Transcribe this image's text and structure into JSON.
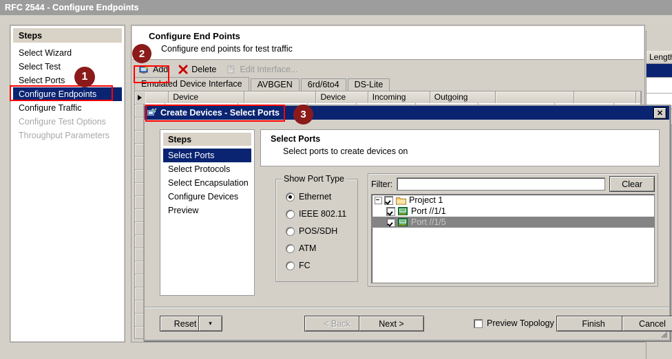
{
  "window": {
    "title": "RFC 2544 - Configure Endpoints"
  },
  "steps_panel": {
    "header": "Steps",
    "items": [
      {
        "label": "Select Wizard",
        "state": "normal"
      },
      {
        "label": "Select Test",
        "state": "normal"
      },
      {
        "label": "Select Ports",
        "state": "normal"
      },
      {
        "label": "Configure Endpoints",
        "state": "selected"
      },
      {
        "label": "Configure Traffic",
        "state": "normal"
      },
      {
        "label": "Configure Test Options",
        "state": "disabled"
      },
      {
        "label": "Throughput Parameters",
        "state": "disabled"
      }
    ]
  },
  "content": {
    "title": "Configure End Points",
    "subtitle": "Configure end points for test traffic",
    "toolbar": [
      {
        "label": "Add",
        "icon": "add-device-icon",
        "enabled": true
      },
      {
        "label": "Delete",
        "icon": "delete-x-icon",
        "enabled": true
      },
      {
        "label": "Edit Interface...",
        "icon": "edit-interface-icon",
        "enabled": false
      }
    ],
    "tabs": [
      {
        "label": "Emulated Device Interface",
        "active": true
      },
      {
        "label": "AVBGEN",
        "active": false
      },
      {
        "label": "6rd/6to4",
        "active": false
      },
      {
        "label": "DS-Lite",
        "active": false
      }
    ],
    "grid_headers": [
      "",
      "Device",
      "",
      "Device",
      "Incoming",
      "Outgoing",
      "",
      "",
      ""
    ]
  },
  "right_strip": {
    "column_header": "Length"
  },
  "dialog": {
    "title": "Create Devices - Select Ports",
    "title_icon": "create-devices-icon",
    "close_label": "✕",
    "steps": {
      "header": "Steps",
      "items": [
        {
          "label": "Select Ports",
          "selected": true
        },
        {
          "label": "Select Protocols",
          "selected": false
        },
        {
          "label": "Select Encapsulation",
          "selected": false
        },
        {
          "label": "Configure Devices",
          "selected": false
        },
        {
          "label": "Preview",
          "selected": false
        }
      ]
    },
    "header": {
      "title": "Select Ports",
      "subtitle": "Select ports to create devices on"
    },
    "port_type": {
      "legend": "Show Port Type",
      "options": [
        {
          "label": "Ethernet",
          "selected": true
        },
        {
          "label": "IEEE 802.11",
          "selected": false
        },
        {
          "label": "POS/SDH",
          "selected": false
        },
        {
          "label": "ATM",
          "selected": false
        },
        {
          "label": "FC",
          "selected": false
        }
      ]
    },
    "filter": {
      "label": "Filter:",
      "value": "",
      "placeholder": "",
      "clear_label": "Clear"
    },
    "tree": [
      {
        "label": "Project 1",
        "level": 0,
        "checked": true,
        "expanded": true,
        "selected": false,
        "icon": "folder-icon"
      },
      {
        "label": "Port //1/1",
        "level": 1,
        "checked": true,
        "selected": false,
        "icon": "port-icon"
      },
      {
        "label": "Port //1/5",
        "level": 1,
        "checked": true,
        "selected": true,
        "icon": "port-icon"
      }
    ],
    "buttons": {
      "reset": "Reset",
      "reset_dropdown": "▾",
      "back": "< Back",
      "next": "Next >",
      "preview_topology": "Preview Topology",
      "preview_topology_checked": false,
      "finish": "Finish",
      "cancel": "Cancel"
    }
  },
  "annotations": {
    "accent_color": "#ff0000",
    "badge_color": "#8b1a1a",
    "badges": [
      {
        "number": "1",
        "target": "configure-endpoints-step"
      },
      {
        "number": "2",
        "target": "add-button"
      },
      {
        "number": "3",
        "target": "create-devices-dialog-title"
      }
    ]
  }
}
